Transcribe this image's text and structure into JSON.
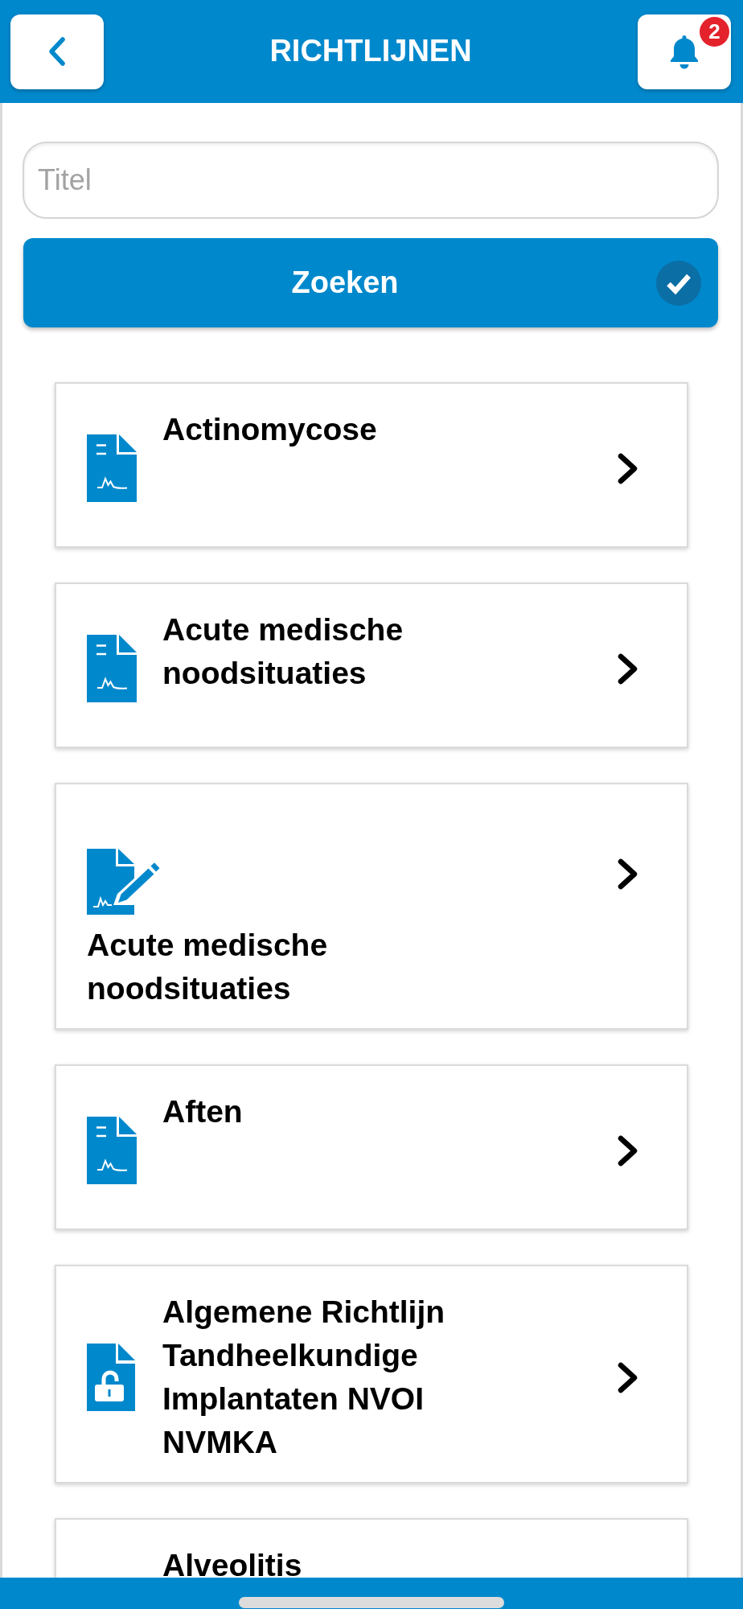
{
  "header": {
    "title": "RICHTLIJNEN",
    "notification_badge": "2"
  },
  "search": {
    "placeholder": "Titel",
    "button": "Zoeken"
  },
  "guidelines": [
    {
      "kind": "document",
      "title": "Actinomycose"
    },
    {
      "kind": "document",
      "title": "Acute medische noodsituaties"
    },
    {
      "kind": "edit",
      "title": "Acute medische noodsituaties"
    },
    {
      "kind": "document",
      "title": "Aften"
    },
    {
      "kind": "unlocked",
      "title": "Algemene Richtlijn Tandheelkundige Implantaten NVOI NVMKA"
    },
    {
      "title": "Alveolitis"
    }
  ]
}
